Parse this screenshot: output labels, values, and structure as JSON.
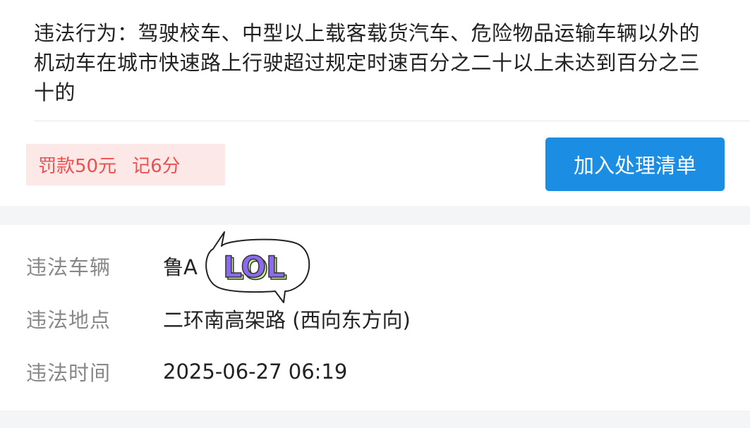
{
  "violation": {
    "description": "违法行为：驾驶校车、中型以上载客载货汽车、危险物品运输车辆以外的机动车在城市快速路上行驶超过规定时速百分之二十以上未达到百分之三十的",
    "fine": "罚款50元",
    "points": "记6分",
    "add_button_label": "加入处理清单"
  },
  "details": {
    "vehicle_label": "违法车辆",
    "vehicle_value": "鲁A",
    "location_label": "违法地点",
    "location_value": "二环南高架路 (西向东方向)",
    "time_label": "违法时间",
    "time_value": "2025-06-27 06:19"
  },
  "sticker": {
    "text": "LOL",
    "icon": "lol-speech-bubble-sticker"
  },
  "colors": {
    "accent": "#1b8de2",
    "penalty_text": "#ee4f4f",
    "penalty_bg": "#fde8e8",
    "sticker_purple": "#8b6cf0",
    "sticker_green": "#c9f28a"
  }
}
